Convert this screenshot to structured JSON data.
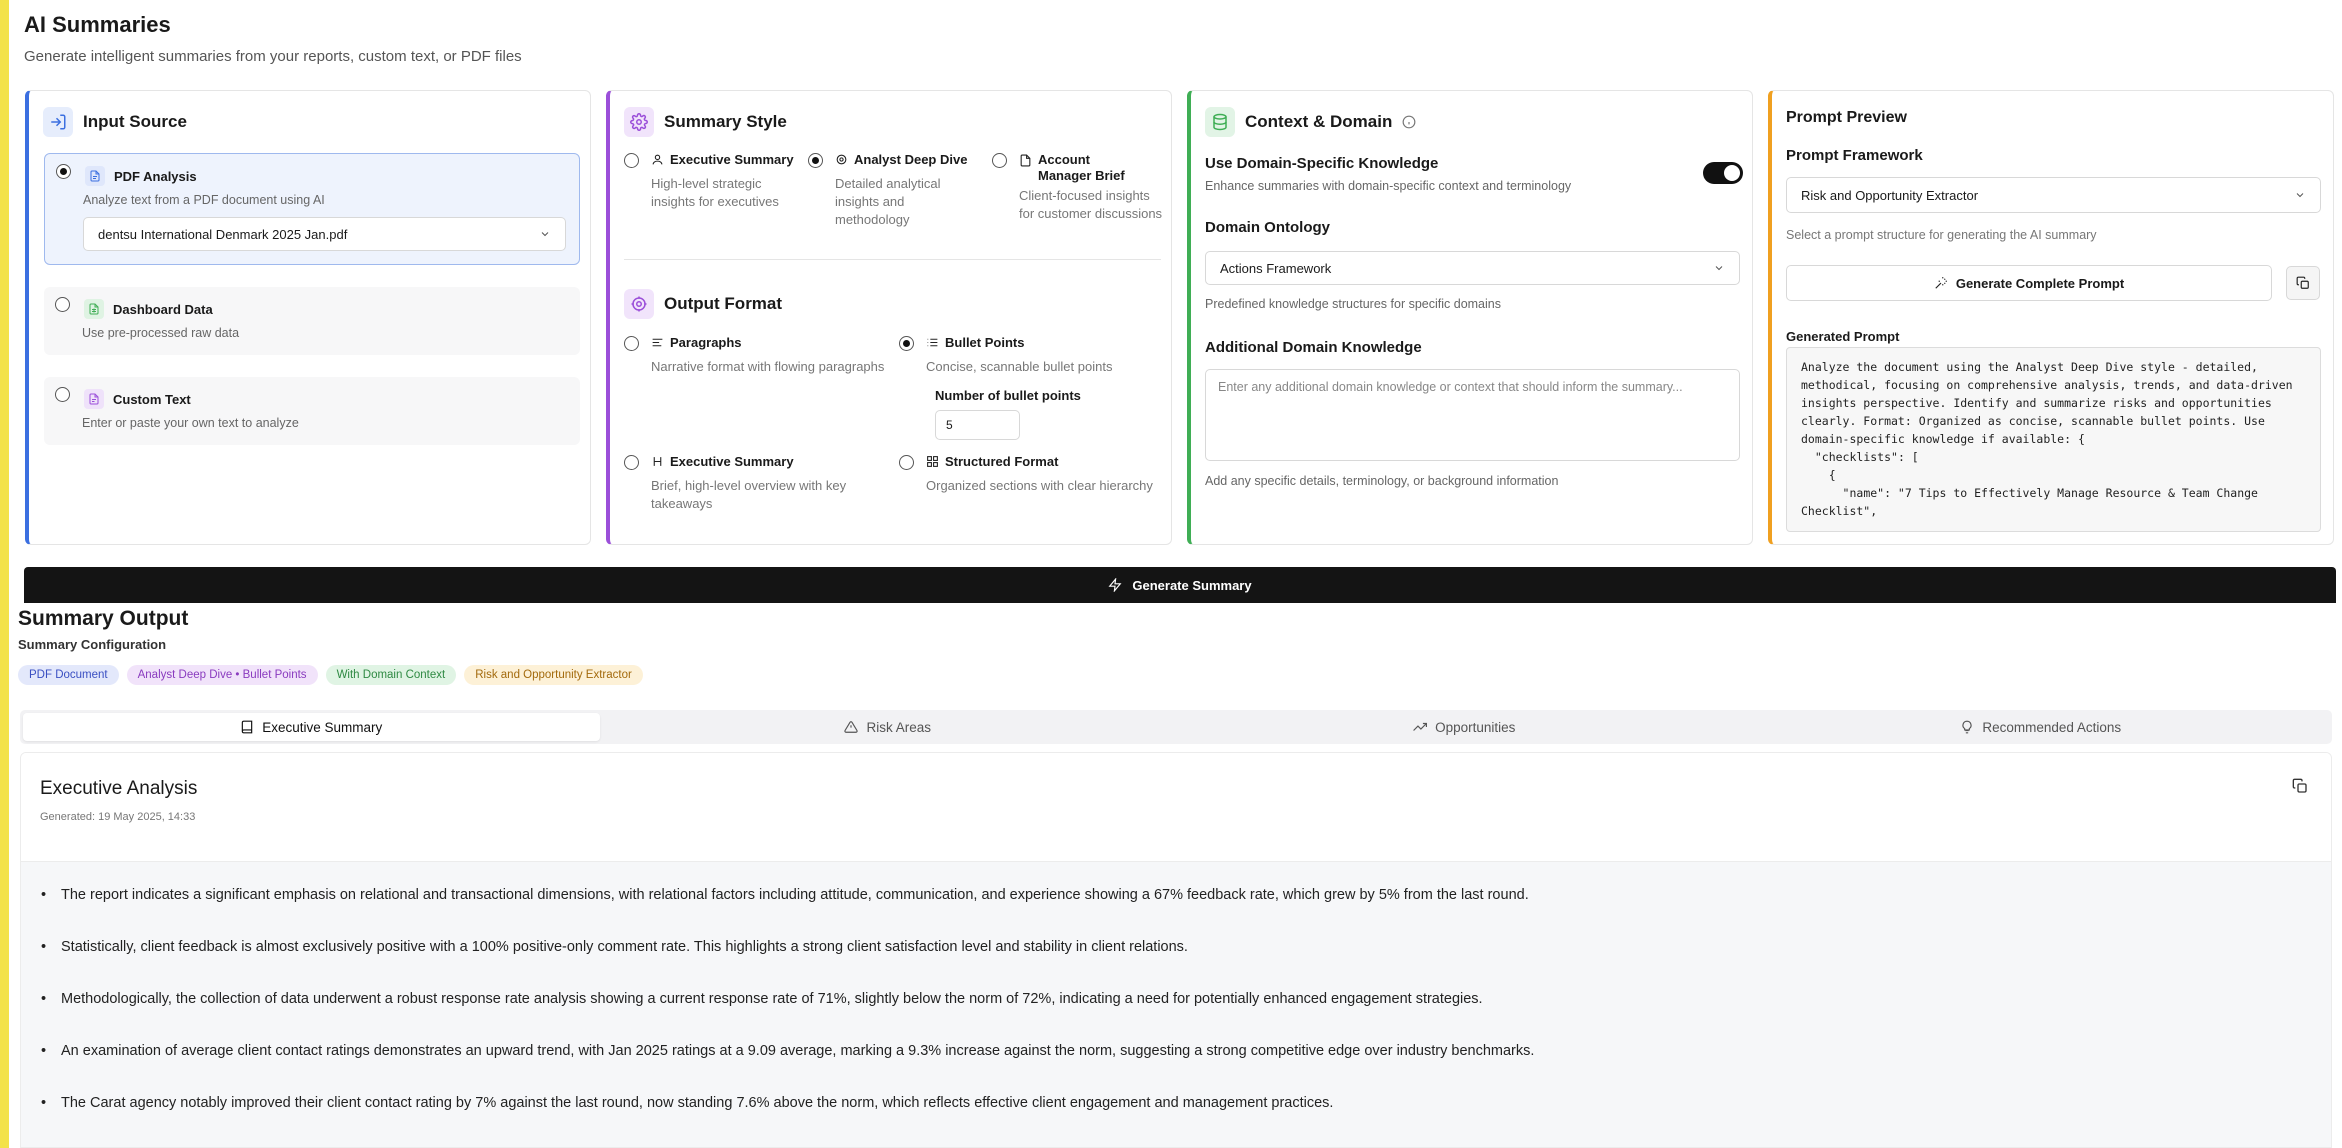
{
  "header": {
    "title": "AI Summaries",
    "subtitle": "Generate intelligent summaries from your reports, custom text, or PDF files"
  },
  "input_source": {
    "title": "Input Source",
    "options": [
      {
        "title": "PDF Analysis",
        "desc": "Analyze text from a PDF document using AI",
        "selected": true
      },
      {
        "title": "Dashboard Data",
        "desc": "Use pre-processed raw data",
        "selected": false
      },
      {
        "title": "Custom Text",
        "desc": "Enter or paste your own text to analyze",
        "selected": false
      }
    ],
    "pdf_select_value": "dentsu International Denmark 2025 Jan.pdf"
  },
  "summary_style": {
    "title": "Summary Style",
    "options": [
      {
        "title": "Executive Summary",
        "desc": "High-level strategic insights for executives",
        "selected": false
      },
      {
        "title": "Analyst Deep Dive",
        "desc": "Detailed analytical insights and methodology",
        "selected": true
      },
      {
        "title": "Account Manager Brief",
        "desc": "Client-focused insights for customer discussions",
        "selected": false
      }
    ]
  },
  "output_format": {
    "title": "Output Format",
    "options": [
      {
        "title": "Paragraphs",
        "desc": "Narrative format with flowing paragraphs",
        "selected": false
      },
      {
        "title": "Bullet Points",
        "desc": "Concise, scannable bullet points",
        "selected": true
      },
      {
        "title": "Executive Summary",
        "desc": "Brief, high-level overview with key takeaways",
        "selected": false
      },
      {
        "title": "Structured Format",
        "desc": "Organized sections with clear hierarchy",
        "selected": false
      }
    ],
    "bullet_count_label": "Number of bullet points",
    "bullet_count_value": "5"
  },
  "context": {
    "title": "Context & Domain",
    "use_domain_label": "Use Domain-Specific Knowledge",
    "use_domain_desc": "Enhance summaries with domain-specific context and terminology",
    "use_domain_on": true,
    "ontology_label": "Domain Ontology",
    "ontology_value": "Actions Framework",
    "ontology_help": "Predefined knowledge structures for specific domains",
    "additional_label": "Additional Domain Knowledge",
    "additional_placeholder": "Enter any additional domain knowledge or context that should inform the summary...",
    "additional_help": "Add any specific details, terminology, or background information"
  },
  "prompt_preview": {
    "title": "Prompt Preview",
    "framework_label": "Prompt Framework",
    "framework_value": "Risk and Opportunity Extractor",
    "framework_help": "Select a prompt structure for generating the AI summary",
    "generate_prompt_label": "Generate Complete Prompt",
    "generated_label": "Generated Prompt",
    "generated_text": "Analyze the document using the Analyst Deep Dive style - detailed, methodical, focusing on comprehensive analysis, trends, and data-driven insights perspective. Identify and summarize risks and opportunities clearly. Format: Organized as concise, scannable bullet points. Use domain-specific knowledge if available: {\n  \"checklists\": [\n    {\n      \"name\": \"7 Tips to Effectively Manage Resource & Team Change Checklist\","
  },
  "generate_button": "Generate Summary",
  "summary_output": {
    "title": "Summary Output",
    "config_label": "Summary Configuration",
    "badges": [
      {
        "label": "PDF Document",
        "bg": "#e3e8fb",
        "fg": "#3a4fc2"
      },
      {
        "label": "Analyst Deep Dive • Bullet Points",
        "bg": "#f1e3fa",
        "fg": "#8a3bbf"
      },
      {
        "label": "With Domain Context",
        "bg": "#e0f4e4",
        "fg": "#2f8a43"
      },
      {
        "label": "Risk and Opportunity Extractor",
        "bg": "#fdf1d7",
        "fg": "#a36a0d"
      }
    ],
    "tabs": [
      {
        "label": "Executive Summary",
        "icon": "book-icon",
        "active": true
      },
      {
        "label": "Risk Areas",
        "icon": "warning-icon",
        "active": false
      },
      {
        "label": "Opportunities",
        "icon": "trending-up-icon",
        "active": false
      },
      {
        "label": "Recommended Actions",
        "icon": "lightbulb-icon",
        "active": false
      }
    ],
    "panel_title": "Executive Analysis",
    "generated_at": "Generated: 19 May 2025, 14:33",
    "bullets": [
      "The report indicates a significant emphasis on relational and transactional dimensions, with relational factors including attitude, communication, and experience showing a 67% feedback rate, which grew by 5% from the last round.",
      "Statistically, client feedback is almost exclusively positive with a 100% positive-only comment rate. This highlights a strong client satisfaction level and stability in client relations.",
      "Methodologically, the collection of data underwent a robust response rate analysis showing a current response rate of 71%, slightly below the norm of 72%, indicating a need for potentially enhanced engagement strategies.",
      "An examination of average client contact ratings demonstrates an upward trend, with Jan 2025 ratings at a 9.09 average, marking a 9.3% increase against the norm, suggesting a strong competitive edge over industry benchmarks.",
      "The Carat agency notably improved their client contact rating by 7% against the last round, now standing 7.6% above the norm, which reflects effective client engagement and management practices."
    ]
  },
  "colors": {
    "input_accent": "#3b6fe0",
    "style_accent": "#9b4fd9",
    "context_accent": "#3fae55",
    "prompt_accent": "#f0a020",
    "rail": "#f3e24a"
  }
}
